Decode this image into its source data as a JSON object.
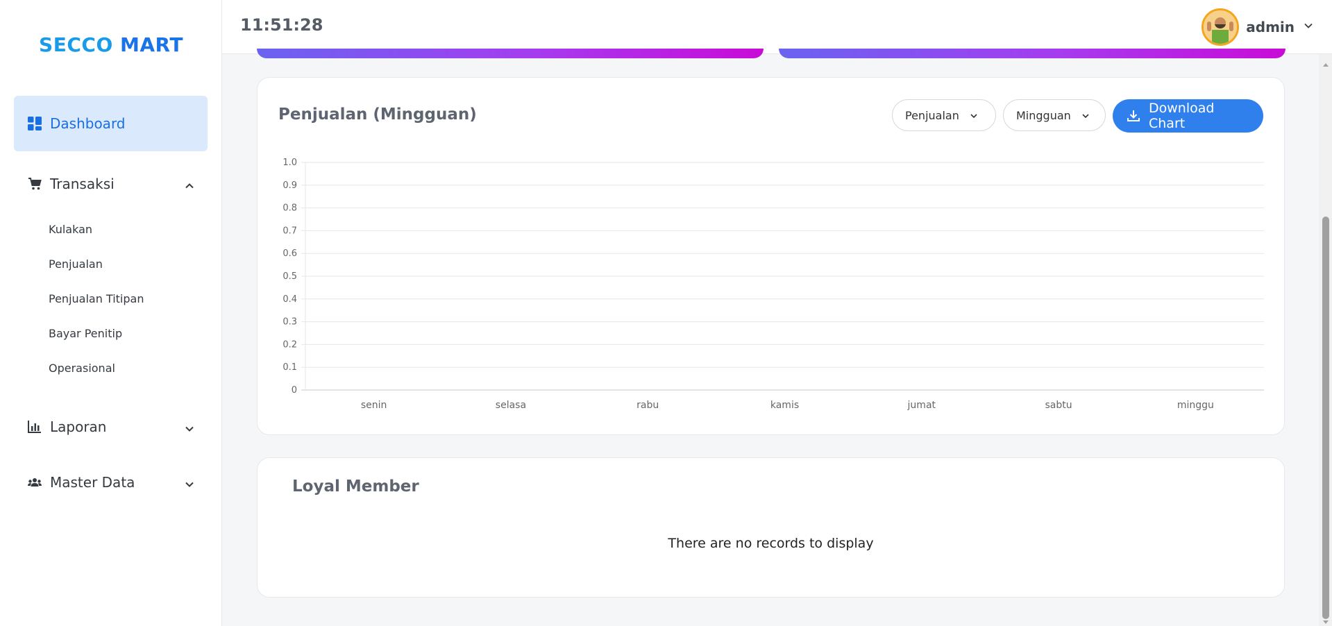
{
  "brand": {
    "part1": "SECCO ",
    "part2": "MART"
  },
  "clock": "11:51:28",
  "user": {
    "name": "admin"
  },
  "sidebar": {
    "dashboard": "Dashboard",
    "transaksi": "Transaksi",
    "transaksi_items": [
      "Kulakan",
      "Penjualan",
      "Penjualan Titipan",
      "Bayar Penitip",
      "Operasional"
    ],
    "laporan": "Laporan",
    "master_data": "Master Data"
  },
  "chart_card": {
    "title": "Penjualan (Mingguan)",
    "filter_type": "Penjualan",
    "filter_period": "Mingguan",
    "download_label": "Download Chart"
  },
  "chart_data": {
    "type": "bar",
    "title": "Penjualan (Mingguan)",
    "categories": [
      "senin",
      "selasa",
      "rabu",
      "kamis",
      "jumat",
      "sabtu",
      "minggu"
    ],
    "values": [
      0,
      0,
      0,
      0,
      0,
      0,
      0
    ],
    "yticks": [
      "0",
      "0.1",
      "0.2",
      "0.3",
      "0.4",
      "0.5",
      "0.6",
      "0.7",
      "0.8",
      "0.9",
      "1.0"
    ],
    "ylim": [
      0,
      1.0
    ],
    "grid": true
  },
  "loyal_member": {
    "title": "Loyal Member",
    "empty_message": "There are no records to display"
  },
  "colors": {
    "accent": "#2f80ed",
    "brand": "#1a9bea",
    "active_bg": "#dbe9fd",
    "gradient_start": "#6a63f0",
    "gradient_end": "#c90bd7"
  },
  "icons": {
    "dashboard": "grid-icon",
    "transaksi": "cart-icon",
    "laporan": "bar-chart-icon",
    "master_data": "users-icon",
    "download": "download-icon"
  }
}
